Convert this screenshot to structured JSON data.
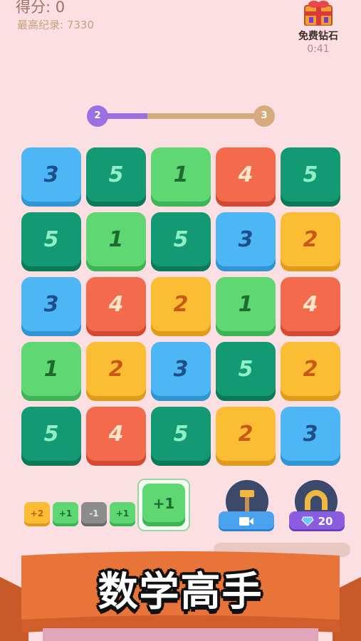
{
  "header": {
    "score_text": "得分: 0",
    "best_text": "最高纪录: 7330"
  },
  "gift": {
    "icon": "gift-box-icon",
    "label": "免费钻石",
    "timer": "0:41"
  },
  "level_progress": {
    "from": "2",
    "to": "3",
    "fraction": 0.3
  },
  "board": [
    [
      {
        "v": "3",
        "c": "blue"
      },
      {
        "v": "5",
        "c": "teal"
      },
      {
        "v": "1",
        "c": "green"
      },
      {
        "v": "4",
        "c": "red"
      },
      {
        "v": "5",
        "c": "teal"
      }
    ],
    [
      {
        "v": "5",
        "c": "teal"
      },
      {
        "v": "1",
        "c": "green"
      },
      {
        "v": "5",
        "c": "teal"
      },
      {
        "v": "3",
        "c": "blue"
      },
      {
        "v": "2",
        "c": "yellow"
      }
    ],
    [
      {
        "v": "3",
        "c": "blue"
      },
      {
        "v": "4",
        "c": "red"
      },
      {
        "v": "2",
        "c": "yellow"
      },
      {
        "v": "1",
        "c": "green"
      },
      {
        "v": "4",
        "c": "red"
      }
    ],
    [
      {
        "v": "1",
        "c": "green"
      },
      {
        "v": "2",
        "c": "yellow"
      },
      {
        "v": "3",
        "c": "blue"
      },
      {
        "v": "5",
        "c": "teal"
      },
      {
        "v": "2",
        "c": "yellow"
      }
    ],
    [
      {
        "v": "5",
        "c": "teal"
      },
      {
        "v": "4",
        "c": "red"
      },
      {
        "v": "5",
        "c": "teal"
      },
      {
        "v": "2",
        "c": "yellow"
      },
      {
        "v": "3",
        "c": "blue"
      }
    ]
  ],
  "queue": [
    {
      "v": "+2",
      "c": "yellow"
    },
    {
      "v": "+1",
      "c": "green"
    },
    {
      "v": "-1",
      "c": "gray"
    },
    {
      "v": "+1",
      "c": "green"
    }
  ],
  "current_piece": "+1",
  "tools": {
    "hammer": {
      "icon": "hammer-icon",
      "button_icon": "video-ad-icon"
    },
    "magnet": {
      "icon": "magnet-icon",
      "button_icon": "diamond-icon",
      "cost": "20"
    }
  },
  "banner": {
    "title": "数学高手"
  },
  "colors": {
    "background": "#fbdfe2",
    "blue": "#4db7f5",
    "teal": "#139a72",
    "green": "#5fd873",
    "red": "#f46a4d",
    "yellow": "#fbbd34",
    "banner": "#e8743a"
  }
}
